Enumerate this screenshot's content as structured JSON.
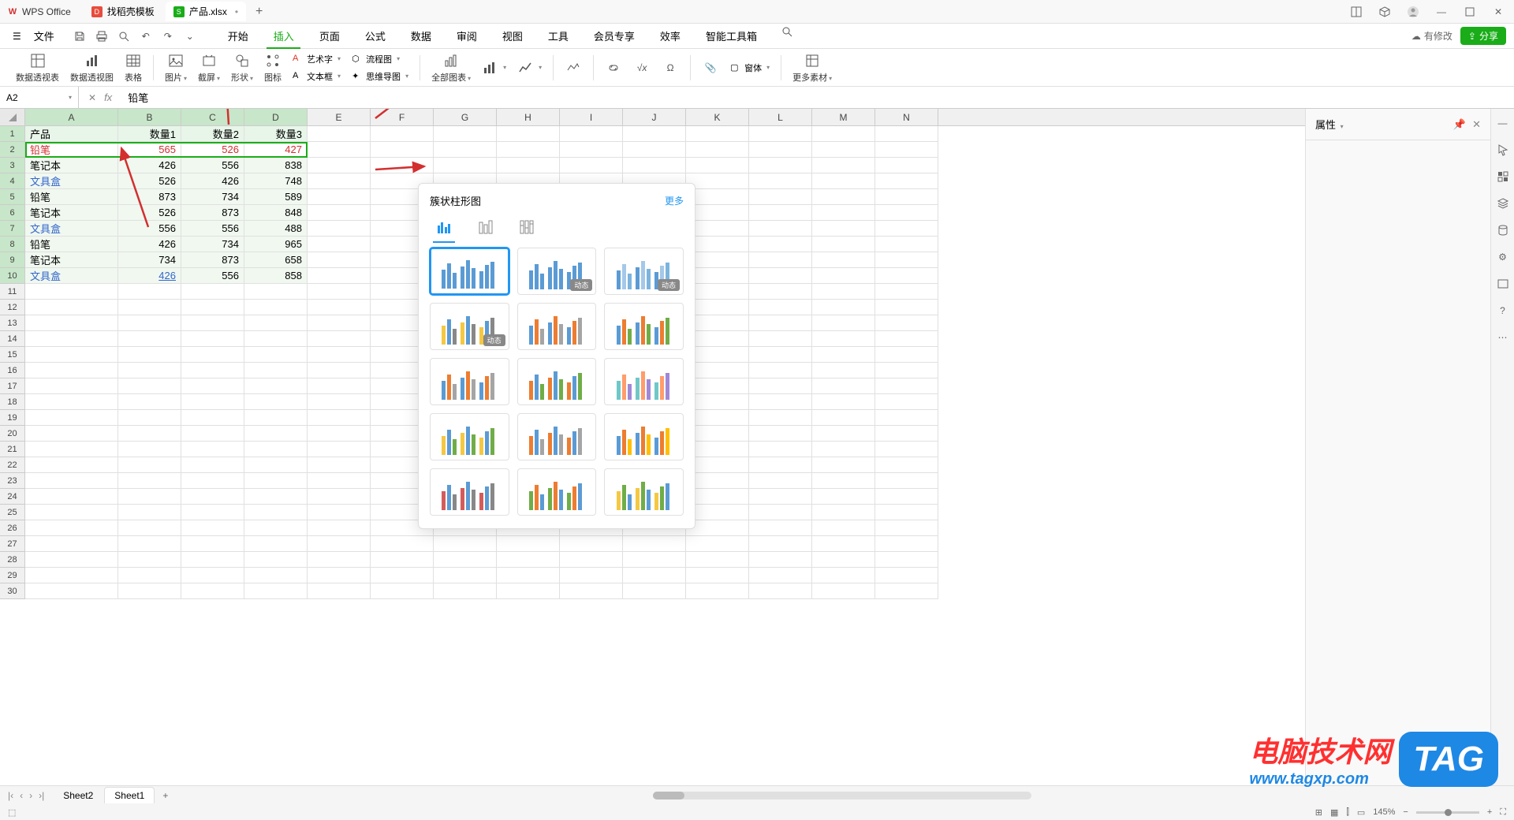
{
  "titlebar": {
    "app_name": "WPS Office",
    "tabs": [
      {
        "label": "找稻壳模板",
        "icon": "red",
        "active": false
      },
      {
        "label": "产品.xlsx",
        "icon": "green",
        "active": true,
        "dirty": "•"
      }
    ]
  },
  "menubar": {
    "file": "文件",
    "tabs": [
      "开始",
      "插入",
      "页面",
      "公式",
      "数据",
      "审阅",
      "视图",
      "工具",
      "会员专享",
      "效率",
      "智能工具箱"
    ],
    "active_tab": "插入",
    "save_status": "有修改",
    "share": "分享"
  },
  "ribbon": {
    "pivot_table": "数据透视表",
    "pivot_chart": "数据透视图",
    "table": "表格",
    "picture": "图片",
    "screenshot": "截屏",
    "shapes": "形状",
    "icons": "图标",
    "wordart": "艺术字",
    "textbox": "文本框",
    "flowchart": "流程图",
    "mindmap": "思维导图",
    "all_charts": "全部图表",
    "cube": "窗体",
    "more_materials": "更多素材"
  },
  "formula_bar": {
    "name_box": "A2",
    "formula": "铅笔"
  },
  "columns": [
    "A",
    "B",
    "C",
    "D",
    "E",
    "F",
    "G",
    "H",
    "I",
    "J",
    "K",
    "L",
    "M",
    "N"
  ],
  "selected_cols": [
    "A",
    "B",
    "C",
    "D"
  ],
  "table": {
    "headers": [
      "产品",
      "数量1",
      "数量2",
      "数量3"
    ],
    "rows": [
      {
        "product": "铅笔",
        "q1": "565",
        "q2": "526",
        "q3": "427",
        "red": true
      },
      {
        "product": "笔记本",
        "q1": "426",
        "q2": "556",
        "q3": "838"
      },
      {
        "product": "文具盒",
        "q1": "526",
        "q2": "426",
        "q3": "748",
        "blue": true
      },
      {
        "product": "铅笔",
        "q1": "873",
        "q2": "734",
        "q3": "589"
      },
      {
        "product": "笔记本",
        "q1": "526",
        "q2": "873",
        "q3": "848"
      },
      {
        "product": "文具盒",
        "q1": "556",
        "q2": "556",
        "q3": "488",
        "blue": true
      },
      {
        "product": "铅笔",
        "q1": "426",
        "q2": "734",
        "q3": "965"
      },
      {
        "product": "笔记本",
        "q1": "734",
        "q2": "873",
        "q3": "658"
      },
      {
        "product": "文具盒",
        "q1": "426",
        "q2": "556",
        "q3": "858",
        "blue": true,
        "underline_q1": true
      }
    ]
  },
  "chart_popup": {
    "title": "簇状柱形图",
    "more": "更多",
    "dynamic_badge": "动态"
  },
  "props_panel": {
    "title": "属性"
  },
  "sheet_tabs": {
    "sheets": [
      "Sheet2",
      "Sheet1"
    ],
    "active": "Sheet1"
  },
  "status_bar": {
    "zoom": "145%"
  },
  "watermark": {
    "cn": "电脑技术网",
    "url": "www.tagxp.com",
    "tag": "TAG"
  },
  "chart_data": {
    "type": "bar",
    "categories": [
      "数量1",
      "数量2",
      "数量3"
    ],
    "series": [
      {
        "name": "铅笔",
        "values": [
          565,
          526,
          427
        ]
      },
      {
        "name": "笔记本",
        "values": [
          426,
          556,
          838
        ]
      },
      {
        "name": "文具盒",
        "values": [
          526,
          426,
          748
        ]
      },
      {
        "name": "铅笔",
        "values": [
          873,
          734,
          589
        ]
      },
      {
        "name": "笔记本",
        "values": [
          526,
          873,
          848
        ]
      },
      {
        "name": "文具盒",
        "values": [
          556,
          556,
          488
        ]
      },
      {
        "name": "铅笔",
        "values": [
          426,
          734,
          965
        ]
      },
      {
        "name": "笔记本",
        "values": [
          734,
          873,
          658
        ]
      },
      {
        "name": "文具盒",
        "values": [
          426,
          556,
          858
        ]
      }
    ],
    "title": "簇状柱形图"
  }
}
